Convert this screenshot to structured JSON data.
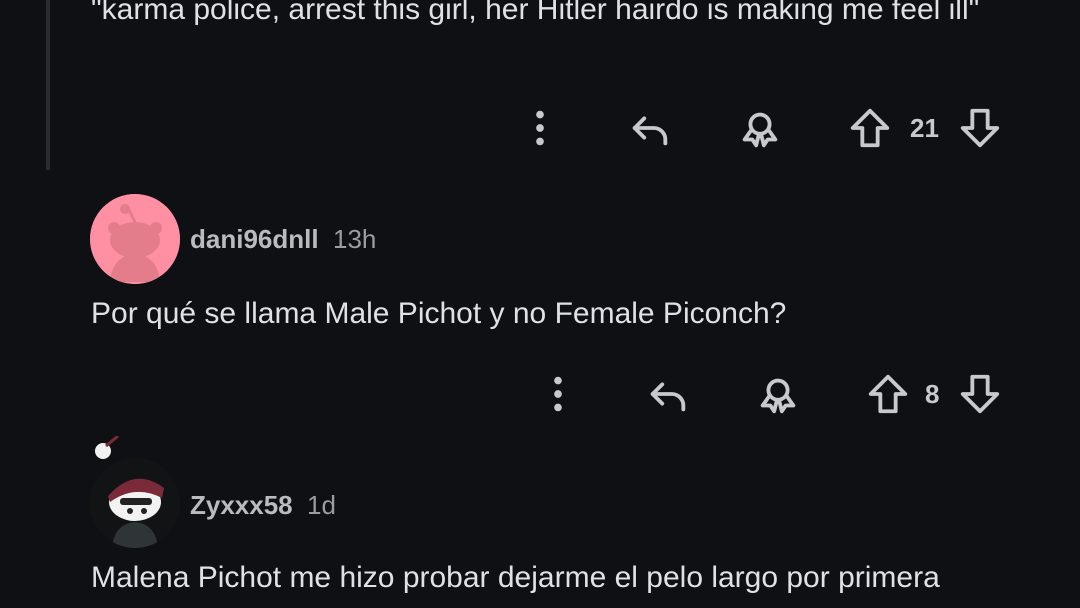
{
  "comments": [
    {
      "text": "\"karma police, arrest this girl, her Hitler hairdo is making me feel ill\"",
      "votes": "21"
    },
    {
      "username": "dani96dnll",
      "time": "13h",
      "text": "Por qué se llama Male Pichot y no Female Piconch?",
      "votes": "8"
    },
    {
      "username": "Zyxxx58",
      "time": "1d",
      "text": "Malena Pichot me hizo probar dejarme el pelo largo por primera"
    }
  ],
  "icons": {
    "more": "more-options-icon",
    "reply": "reply-icon",
    "award": "award-icon",
    "upvote": "upvote-icon",
    "downvote": "downvote-icon"
  },
  "colors": {
    "background": "#0e1013",
    "text": "#dfe1e3",
    "icon": "#c7cacd",
    "avatar1_bg": "#ff8fa3"
  }
}
